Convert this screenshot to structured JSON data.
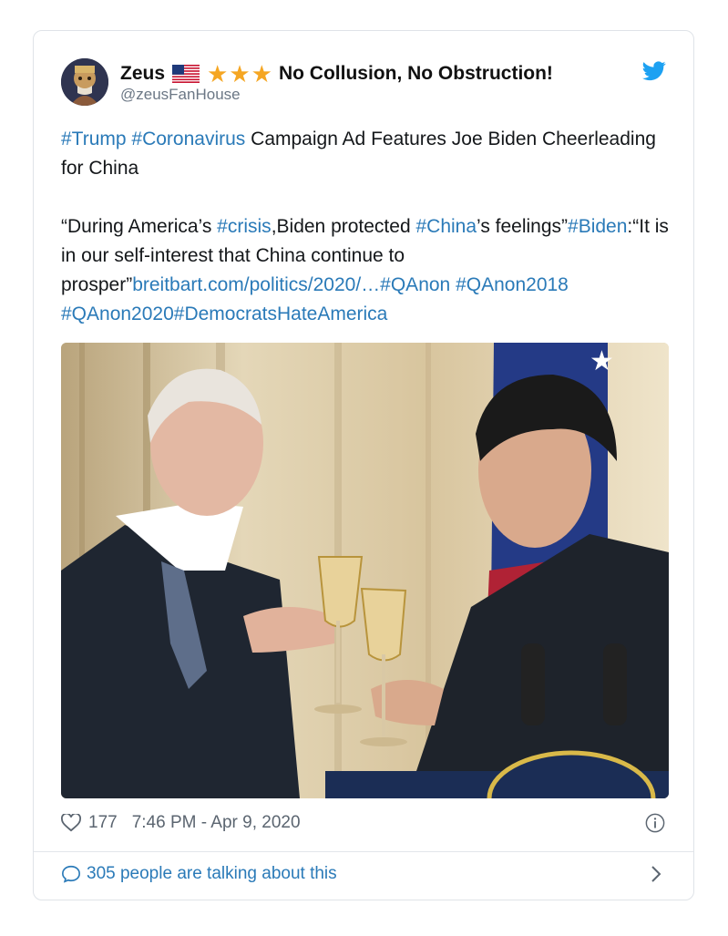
{
  "user": {
    "name": "Zeus",
    "stars": "★★★",
    "name_suffix": "No Collusion, No Obstruction!",
    "handle": "@zeusFanHouse"
  },
  "tweet": {
    "line1_tags": "#Trump #Coronavirus",
    "line1_text": " Campaign Ad Features Joe Biden Cheerleading for China",
    "p2_a": "“During America’s ",
    "p2_tag1": "#crisis",
    "p2_b": ",Biden protected ",
    "p2_tag2": "#China",
    "p2_c": "’s feelings”",
    "p2_tag3": "#Biden",
    "p2_d": ":“It is in our self-interest that China continue to prosper”",
    "p2_link": "breitbart.com/politics/2020/…",
    "p2_tag4": "#QAnon",
    "p2_tag5": "#QAnon2018",
    "p2_tag6": "#QAnon2020#DemocratsHateAmerica"
  },
  "meta": {
    "likes": "177",
    "timestamp": "7:46 PM - Apr 9, 2020"
  },
  "footer": {
    "talking": "305 people are talking about this"
  },
  "colors": {
    "link": "#2a7ab8",
    "twitter_blue": "#1da1f2",
    "star": "#f5a623"
  }
}
